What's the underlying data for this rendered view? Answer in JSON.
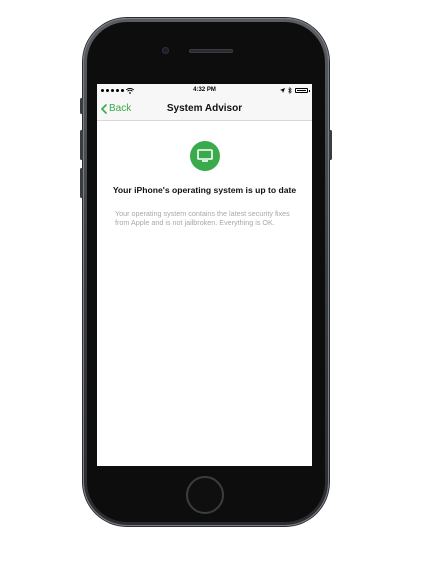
{
  "status_bar": {
    "carrier_signal_icon": "signal-dots-icon",
    "wifi_icon": "wifi-icon",
    "time": "4:32 PM",
    "location_icon": "location-arrow-icon",
    "bluetooth_icon": "bluetooth-icon",
    "battery_icon": "battery-icon"
  },
  "nav": {
    "back_label": "Back",
    "back_icon": "chevron-left-icon",
    "title": "System Advisor"
  },
  "content": {
    "status_icon": "monitor-icon",
    "accent_color": "#3aab4c",
    "headline": "Your iPhone's operating system is up to date",
    "description": "Your operating system contains the latest security fixes from Apple and is not jailbroken. Everything is OK."
  }
}
